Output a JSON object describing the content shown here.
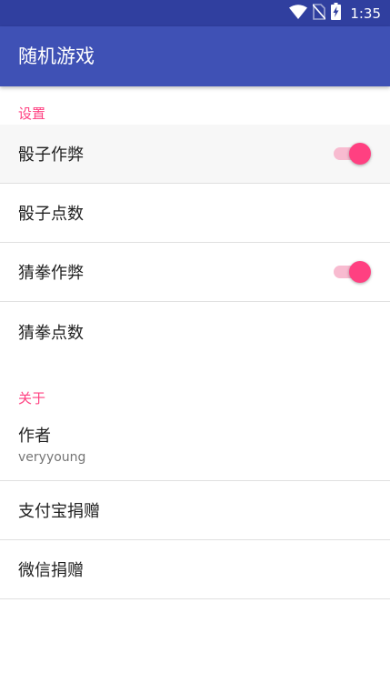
{
  "status_bar": {
    "time": "1:35",
    "icons": [
      "wifi-icon",
      "no-sim-icon",
      "battery-charging-icon"
    ]
  },
  "app_bar": {
    "title": "随机游戏"
  },
  "settings": {
    "category_label": "设置",
    "items": [
      {
        "label": "骰子作弊",
        "type": "switch",
        "checked": true
      },
      {
        "label": "骰子点数",
        "type": "preference"
      },
      {
        "label": "猜拳作弊",
        "type": "switch",
        "checked": true
      },
      {
        "label": "猜拳点数",
        "type": "preference"
      }
    ]
  },
  "about": {
    "category_label": "关于",
    "items": [
      {
        "label": "作者",
        "summary": "veryyoung"
      },
      {
        "label": "支付宝捐赠"
      },
      {
        "label": "微信捐赠"
      }
    ]
  },
  "colors": {
    "status_bar": "#303f9f",
    "app_bar": "#3f51b5",
    "accent": "#ff4081",
    "switch_track": "#f8bbd0"
  }
}
